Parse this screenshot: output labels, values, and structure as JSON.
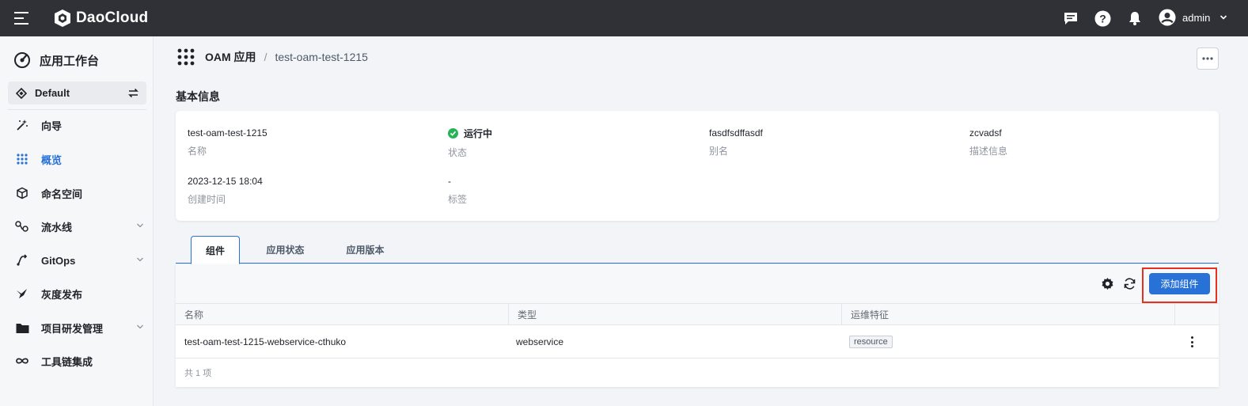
{
  "header": {
    "brand": "DaoCloud",
    "user": "admin",
    "icons": [
      "menu-icon",
      "chat-icon",
      "help-icon",
      "bell-icon",
      "user-avatar-icon",
      "chevron-down-icon"
    ]
  },
  "sidebar": {
    "title": "应用工作台",
    "workspace": "Default",
    "items": [
      {
        "label": "向导",
        "icon": "wand-icon"
      },
      {
        "label": "概览",
        "icon": "grid-icon",
        "active": true
      },
      {
        "label": "命名空间",
        "icon": "cube-icon"
      },
      {
        "label": "流水线",
        "icon": "pipeline-icon",
        "expandable": true
      },
      {
        "label": "GitOps",
        "icon": "gitops-icon",
        "expandable": true
      },
      {
        "label": "灰度发布",
        "icon": "bird-icon"
      },
      {
        "label": "项目研发管理",
        "icon": "folder-icon",
        "expandable": true
      },
      {
        "label": "工具链集成",
        "icon": "infinity-icon"
      }
    ]
  },
  "breadcrumb": {
    "parent": "OAM 应用",
    "separator": "/",
    "current": "test-oam-test-1215"
  },
  "basic_info": {
    "section_title": "基本信息",
    "fields": {
      "name": {
        "value": "test-oam-test-1215",
        "label": "名称"
      },
      "status": {
        "value": "运行中",
        "label": "状态"
      },
      "alias": {
        "value": "fasdfsdffasdf",
        "label": "别名"
      },
      "description": {
        "value": "zcvadsf",
        "label": "描述信息"
      },
      "created": {
        "value": "2023-12-15 18:04",
        "label": "创建时间"
      },
      "tags": {
        "value": "-",
        "label": "标签"
      }
    }
  },
  "tabs": [
    "组件",
    "应用状态",
    "应用版本"
  ],
  "components": {
    "add_button": "添加组件",
    "columns": [
      "名称",
      "类型",
      "运维特征"
    ],
    "rows": [
      {
        "name": "test-oam-test-1215-webservice-cthuko",
        "type": "webservice",
        "trait": "resource"
      }
    ],
    "total": "共 1 项"
  },
  "colors": {
    "topbar": "#2f3136",
    "accent": "#2771d7",
    "status_running": "#27b258",
    "highlight": "#e8301f"
  }
}
